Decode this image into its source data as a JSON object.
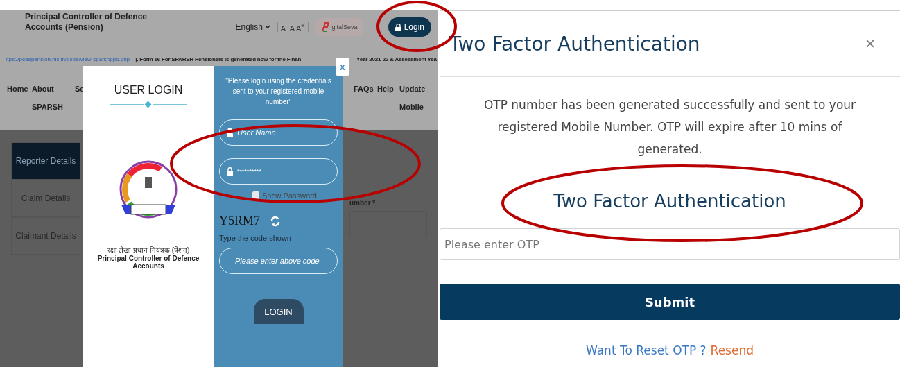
{
  "left_screen": {
    "header": {
      "title_lines": [
        "Principal Controller of Defence",
        "Accounts (Pension)"
      ],
      "language": "English",
      "font_sizes": "A$^{-}$ A A$^{+}$",
      "partner_logo_text": "igitalSeva",
      "login_button": "Login"
    },
    "ticker": {
      "link": "ttps://pcdapension.nic.in/pcda/view-sparshppo.php",
      "text": "|. Form 16 For SPARSH Pensioners is generated now for the Finan",
      "text_2": "Year 2021-22 & Assessment Yea"
    },
    "nav": [
      "Home",
      "About SPARSH",
      "Se",
      "FAQs",
      "Help",
      "Update Mobile"
    ],
    "side_tabs": [
      {
        "label": "Reporter Details",
        "selected": true
      },
      {
        "label": "Claim Details",
        "selected": false
      },
      {
        "label": "Claimant Details",
        "selected": false
      }
    ],
    "field_label": "umber *",
    "modal": {
      "close": "x",
      "title": "USER LOGIN",
      "emblem_caption_hindi": "रक्षा लेखा प्रधान नियंत्रक (पेंशन)",
      "emblem_caption": "Principal Controller of Defence Accounts",
      "note": "\"Please login using the credentials sent to your registered mobile number\"",
      "username_placeholder": "User Name",
      "password_value": "**********",
      "show_password": {
        "label": "Show Password",
        "checked": false
      },
      "captcha": "Y5RM7",
      "captcha_hint": "Type the code shown",
      "code_placeholder": "Please enter above code",
      "login_button": "LOGIN"
    }
  },
  "right_screen": {
    "title": "Two Factor Authentication",
    "close": "×",
    "message": "OTP number has been generated successfully and sent to your registered Mobile Number. OTP will expire after 10 mins of generated.",
    "subtitle": "Two Factor Authentication",
    "otp_placeholder": "Please enter OTP",
    "submit": "Submit",
    "reset_prompt": "Want To Reset OTP ?",
    "resend": "Resend"
  },
  "annotations": [
    {
      "kind": "ellipse"
    },
    {
      "kind": "ellipse"
    },
    {
      "kind": "ellipse"
    }
  ]
}
